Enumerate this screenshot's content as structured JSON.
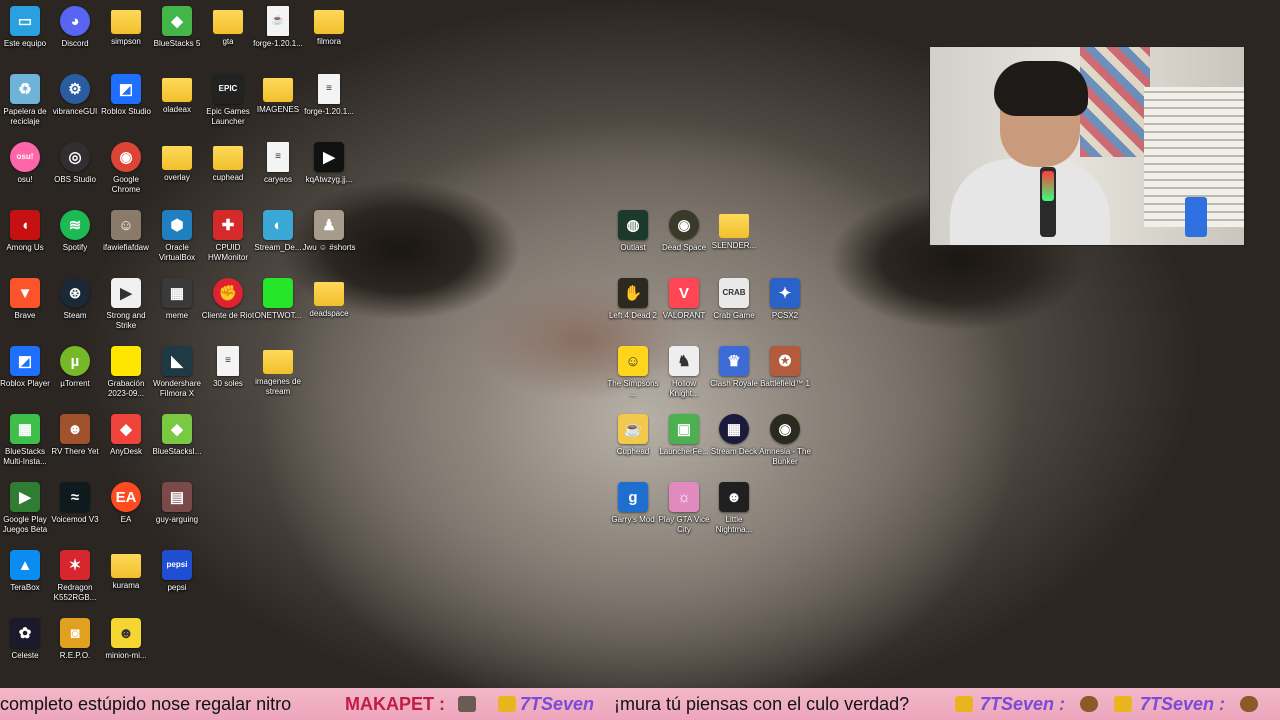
{
  "desktop": {
    "icons": [
      {
        "label": "Este equipo",
        "kind": "app",
        "glyph": "▭",
        "color": "#2aa0e0",
        "icon": "monitor-icon"
      },
      {
        "label": "Discord",
        "kind": "app-round",
        "glyph": "◕",
        "color": "#5865f2",
        "icon": "discord-icon"
      },
      {
        "label": "simpson",
        "kind": "folder",
        "glyph": "",
        "color": "#f2bf2c",
        "icon": "folder-icon"
      },
      {
        "label": "BlueStacks 5",
        "kind": "app",
        "glyph": "◆",
        "color": "#44b649",
        "icon": "bluestacks-icon"
      },
      {
        "label": "gta",
        "kind": "folder",
        "glyph": "",
        "color": "#f2bf2c",
        "icon": "folder-icon"
      },
      {
        "label": "forge-1.20.1...",
        "kind": "file",
        "glyph": "☕",
        "color": "#f4f4f4",
        "icon": "java-icon"
      },
      {
        "label": "filmora",
        "kind": "folder",
        "glyph": "",
        "color": "#f2bf2c",
        "icon": "folder-icon"
      },
      {
        "label": "Papelera de reciclaje",
        "kind": "app",
        "glyph": "♻",
        "color": "#6fb3d8",
        "icon": "recycle-bin-icon"
      },
      {
        "label": "vibranceGUI",
        "kind": "app-round",
        "glyph": "⚙",
        "color": "#2a5d9f",
        "icon": "gear-icon"
      },
      {
        "label": "Roblox Studio",
        "kind": "app",
        "glyph": "◩",
        "color": "#1f6fff",
        "icon": "roblox-studio-icon"
      },
      {
        "label": "oladeax",
        "kind": "folder",
        "glyph": "",
        "color": "#f2bf2c",
        "icon": "folder-icon"
      },
      {
        "label": "Epic Games Launcher",
        "kind": "app",
        "glyph": "EPIC",
        "color": "#222222",
        "icon": "epic-games-icon"
      },
      {
        "label": "IMAGENES",
        "kind": "folder",
        "glyph": "",
        "color": "#f2bf2c",
        "icon": "folder-icon"
      },
      {
        "label": "forge-1.20.1...",
        "kind": "file",
        "glyph": "≡",
        "color": "#f4f4f4",
        "icon": "document-icon"
      },
      {
        "label": "osu!",
        "kind": "app-round",
        "glyph": "osu!",
        "color": "#ff66aa",
        "icon": "osu-icon"
      },
      {
        "label": "OBS Studio",
        "kind": "app-round",
        "glyph": "◎",
        "color": "#302e31",
        "icon": "obs-icon"
      },
      {
        "label": "Google Chrome",
        "kind": "app-round",
        "glyph": "◉",
        "color": "#db4437",
        "icon": "chrome-icon"
      },
      {
        "label": "overlay",
        "kind": "folder",
        "glyph": "",
        "color": "#f2bf2c",
        "icon": "folder-icon"
      },
      {
        "label": "cuphead",
        "kind": "folder",
        "glyph": "",
        "color": "#f2bf2c",
        "icon": "folder-icon"
      },
      {
        "label": "caryeos",
        "kind": "file",
        "glyph": "≡",
        "color": "#f4f4f4",
        "icon": "document-icon"
      },
      {
        "label": "kqAtwzyg.jj...",
        "kind": "app",
        "glyph": "▶",
        "color": "#111111",
        "icon": "image-file-icon"
      },
      {
        "label": "Among Us",
        "kind": "app",
        "glyph": "◖",
        "color": "#c51111",
        "icon": "among-us-icon"
      },
      {
        "label": "Spotify",
        "kind": "app-round",
        "glyph": "≋",
        "color": "#1db954",
        "icon": "spotify-icon"
      },
      {
        "label": "ifawiefiafdaw",
        "kind": "app",
        "glyph": "☺",
        "color": "#8a7a6a",
        "icon": "photo-icon"
      },
      {
        "label": "Oracle VirtualBox",
        "kind": "app",
        "glyph": "⬢",
        "color": "#1f7fbf",
        "icon": "virtualbox-icon"
      },
      {
        "label": "CPUID HWMonitor",
        "kind": "app",
        "glyph": "✚",
        "color": "#d42a2a",
        "icon": "hwmonitor-icon"
      },
      {
        "label": "Stream_De...",
        "kind": "app",
        "glyph": "◐",
        "color": "#3aa7d6",
        "icon": "stream-deck-file-icon"
      },
      {
        "label": "Jwu ☺ #shorts",
        "kind": "app",
        "glyph": "♟",
        "color": "#a79c8c",
        "icon": "video-icon"
      },
      {
        "label": "Brave",
        "kind": "app",
        "glyph": "▼",
        "color": "#fb542b",
        "icon": "brave-icon"
      },
      {
        "label": "Steam",
        "kind": "app-round",
        "glyph": "⊛",
        "color": "#1b2838",
        "icon": "steam-icon"
      },
      {
        "label": "Strong and Strike",
        "kind": "app",
        "glyph": "▶",
        "color": "#f0f0f0",
        "icon": "video-file-icon"
      },
      {
        "label": "meme",
        "kind": "app",
        "glyph": "▦",
        "color": "#3a3a3a",
        "icon": "video-thumbnail-icon"
      },
      {
        "label": "Cliente de Riot",
        "kind": "app-round",
        "glyph": "✊",
        "color": "#e0212f",
        "icon": "riot-icon"
      },
      {
        "label": "ONETWOT...",
        "kind": "app",
        "glyph": "",
        "color": "#26e62a",
        "icon": "green-image-icon"
      },
      {
        "label": "deadspace",
        "kind": "folder",
        "glyph": "",
        "color": "#f2bf2c",
        "icon": "folder-icon"
      },
      {
        "label": "Roblox Player",
        "kind": "app",
        "glyph": "◩",
        "color": "#1f6fff",
        "icon": "roblox-player-icon"
      },
      {
        "label": "µTorrent",
        "kind": "app-round",
        "glyph": "µ",
        "color": "#76b82a",
        "icon": "utorrent-icon"
      },
      {
        "label": "Grabación 2023-09...",
        "kind": "app",
        "glyph": "",
        "color": "#ffe600",
        "icon": "recording-icon"
      },
      {
        "label": "Wondershare Filmora X",
        "kind": "app",
        "glyph": "◣",
        "color": "#1f3a44",
        "icon": "filmora-icon"
      },
      {
        "label": "30 soles",
        "kind": "file",
        "glyph": "≡",
        "color": "#f4f4f4",
        "icon": "document-icon"
      },
      {
        "label": "imagenes de stream",
        "kind": "folder",
        "glyph": "",
        "color": "#f2bf2c",
        "icon": "folder-icon"
      },
      {
        "label": "BlueStacks Multi-Insta...",
        "kind": "app",
        "glyph": "▦",
        "color": "#3fbf4a",
        "icon": "bluestacks-multi-icon"
      },
      {
        "label": "RV There Yet",
        "kind": "app",
        "glyph": "☻",
        "color": "#a0522d",
        "icon": "rv-there-yet-icon"
      },
      {
        "label": "AnyDesk",
        "kind": "app",
        "glyph": "◆",
        "color": "#ef443b",
        "icon": "anydesk-icon"
      },
      {
        "label": "BlueStacksI...",
        "kind": "app",
        "glyph": "◆",
        "color": "#7ac943",
        "icon": "bluestacks-icon"
      },
      {
        "label": "Google Play Juegos Beta",
        "kind": "app",
        "glyph": "▶",
        "color": "#2e7d32",
        "icon": "google-play-games-icon"
      },
      {
        "label": "Voicemod V3",
        "kind": "app",
        "glyph": "≈",
        "color": "#0f1a1f",
        "icon": "voicemod-icon"
      },
      {
        "label": "EA",
        "kind": "app-round",
        "glyph": "EA",
        "color": "#ff4b1f",
        "icon": "ea-icon"
      },
      {
        "label": "guy-arguing",
        "kind": "app",
        "glyph": "▤",
        "color": "#7a4a4a",
        "icon": "gif-icon"
      },
      {
        "label": "TeraBox",
        "kind": "app",
        "glyph": "▲",
        "color": "#0a8cf0",
        "icon": "terabox-icon"
      },
      {
        "label": "Redragon K552RGB...",
        "kind": "app",
        "glyph": "✶",
        "color": "#d7262e",
        "icon": "redragon-icon"
      },
      {
        "label": "kurama",
        "kind": "folder",
        "glyph": "",
        "color": "#f2bf2c",
        "icon": "folder-icon"
      },
      {
        "label": "pepsi",
        "kind": "app",
        "glyph": "pepsi",
        "color": "#1f4fd0",
        "icon": "pepsi-image-icon"
      },
      {
        "label": "Celeste",
        "kind": "app",
        "glyph": "✿",
        "color": "#1a1a2a",
        "icon": "celeste-icon"
      },
      {
        "label": "R.E.P.O.",
        "kind": "app",
        "glyph": "◙",
        "color": "#e0a020",
        "icon": "repo-icon"
      },
      {
        "label": "minion-mi...",
        "kind": "app",
        "glyph": "☻",
        "color": "#f5d630",
        "icon": "minion-icon"
      },
      {
        "label": "Outlast",
        "kind": "app",
        "glyph": "◍",
        "color": "#1c3a2c",
        "icon": "outlast-icon"
      },
      {
        "label": "Dead Space",
        "kind": "app-round",
        "glyph": "◉",
        "color": "#3a3a2a",
        "icon": "dead-space-icon"
      },
      {
        "label": "SLENDER...",
        "kind": "folder",
        "glyph": "",
        "color": "#f2bf2c",
        "icon": "folder-icon"
      },
      {
        "label": "Left 4 Dead 2",
        "kind": "app",
        "glyph": "✋",
        "color": "#2c2a20",
        "icon": "left4dead-icon"
      },
      {
        "label": "VALORANT",
        "kind": "app",
        "glyph": "V",
        "color": "#ff4655",
        "icon": "valorant-icon"
      },
      {
        "label": "Crab Game",
        "kind": "app",
        "glyph": "CRAB",
        "color": "#e9e9e9",
        "icon": "crab-game-icon"
      },
      {
        "label": "PCSX2",
        "kind": "app",
        "glyph": "✦",
        "color": "#2a62c8",
        "icon": "pcsx2-icon"
      },
      {
        "label": "The Simpsons ...",
        "kind": "app",
        "glyph": "☺",
        "color": "#fed41d",
        "icon": "simpsons-icon"
      },
      {
        "label": "Hollow Knight...",
        "kind": "app",
        "glyph": "♞",
        "color": "#eeeeee",
        "icon": "hollow-knight-icon"
      },
      {
        "label": "Clash Royale",
        "kind": "app",
        "glyph": "♛",
        "color": "#3d6bd6",
        "icon": "clash-royale-icon"
      },
      {
        "label": "Battlefield™ 1",
        "kind": "app",
        "glyph": "✪",
        "color": "#b35b3a",
        "icon": "battlefield-icon"
      },
      {
        "label": "Cuphead",
        "kind": "app",
        "glyph": "☕",
        "color": "#f2c94c",
        "icon": "cuphead-icon"
      },
      {
        "label": "LauncherFe...",
        "kind": "app",
        "glyph": "▣",
        "color": "#4caf50",
        "icon": "minecraft-launcher-icon"
      },
      {
        "label": "Stream Deck",
        "kind": "app-round",
        "glyph": "▦",
        "color": "#1a1a3a",
        "icon": "stream-deck-icon"
      },
      {
        "label": "Amnesia - The Bunker",
        "kind": "app-round",
        "glyph": "◉",
        "color": "#2a2a20",
        "icon": "amnesia-icon"
      },
      {
        "label": "Garry's Mod",
        "kind": "app",
        "glyph": "g",
        "color": "#1f6fd0",
        "icon": "garrys-mod-icon"
      },
      {
        "label": "Play GTA Vice City",
        "kind": "app",
        "glyph": "☼",
        "color": "#e08ac0",
        "icon": "gta-vice-city-icon"
      },
      {
        "label": "Little Nightma...",
        "kind": "app",
        "glyph": "☻",
        "color": "#202020",
        "icon": "little-nightmares-icon"
      }
    ]
  },
  "chat": {
    "text_a": "completo estúpido nose regalar nitro",
    "user_a": "MAKAPET :",
    "user_b": "7TSeven",
    "text_b": "¡mura tú piensas con el culo verdad?",
    "user_c": "7TSeven :",
    "user_d": "7TSeven :"
  },
  "colors": {
    "chat_bg": "#eea6bd",
    "chat_user": "#c21c44",
    "chat_user_sub": "#7a4ad8"
  }
}
